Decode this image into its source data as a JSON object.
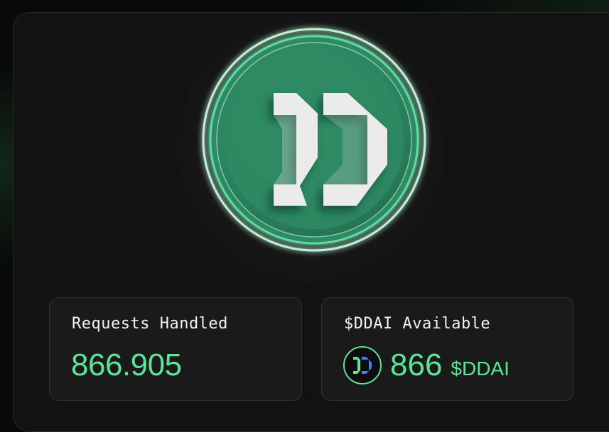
{
  "stats": {
    "requests": {
      "label": "Requests Handled",
      "value": "866.905"
    },
    "available": {
      "label": "$DDAI Available",
      "amount": "866",
      "unit": "$DDAI",
      "icon": "ddai-token-icon"
    }
  },
  "logo": {
    "icon": "ddai-logo-coin-icon"
  },
  "colors": {
    "accent": "#5ee39a",
    "coin": "#2f8a63",
    "card": "#121212",
    "box": "#1a1a1a"
  }
}
